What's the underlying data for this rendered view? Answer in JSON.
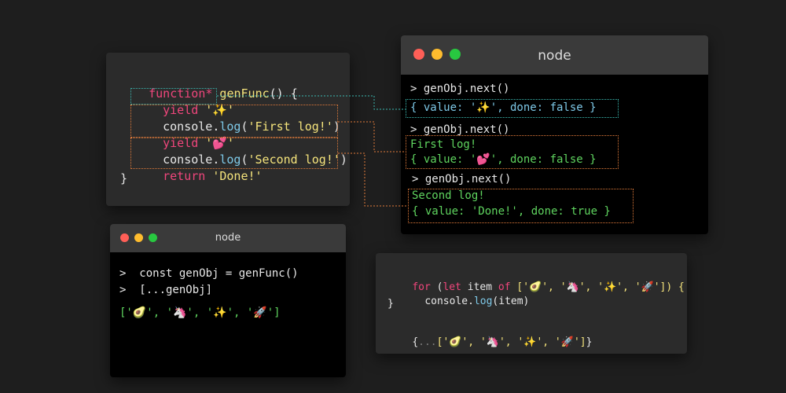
{
  "code_panel": {
    "lines": [
      {
        "kw": "function*",
        "fn": " genFunc",
        "rest": "() {"
      },
      {
        "kw": "yield",
        "str": " '✨'"
      },
      {
        "obj": "console.",
        "mth": "log",
        "open": "(",
        "str": "'First log!'",
        "close": ")"
      },
      {
        "kw": "yield",
        "str": " '💕'"
      },
      {
        "obj": "console.",
        "mth": "log",
        "open": "(",
        "str": "'Second log!'",
        "close": ")"
      },
      {
        "kw": "return",
        "str": " 'Done!'"
      },
      {
        "text": "}"
      }
    ]
  },
  "node_top": {
    "title": "node",
    "lines": [
      "> genObj.next()",
      "{ value: '✨', done: false }",
      "> genObj.next()",
      "First log!",
      "{ value: '💕', done: false }",
      "> genObj.next()",
      "Second log!",
      "{ value: 'Done!', done: true }"
    ]
  },
  "node_bottom": {
    "title": "node",
    "lines": [
      ">  const genObj = genFunc()",
      ">  [...genObj]",
      "['🥑', '🦄', '✨', '🚀']"
    ]
  },
  "loop_panel": {
    "for_kw": "for",
    "for_open": " (",
    "let_kw": "let",
    "item": " item ",
    "of_kw": "of",
    "array": " ['🥑', '🦄', '✨', '🚀']) {",
    "body_obj": "console.",
    "body_mth": "log",
    "body_arg": "(item)",
    "close": "}",
    "spread_open": "{",
    "spread_dots": "...",
    "spread_array": "['🥑', '🦄', '✨', '🚀']",
    "spread_close": "}"
  },
  "colors": {
    "teal": "#3bb8b0",
    "orange": "#e07a3a",
    "red": "#ff5f57",
    "yellow": "#febc2e",
    "green": "#28c840"
  }
}
